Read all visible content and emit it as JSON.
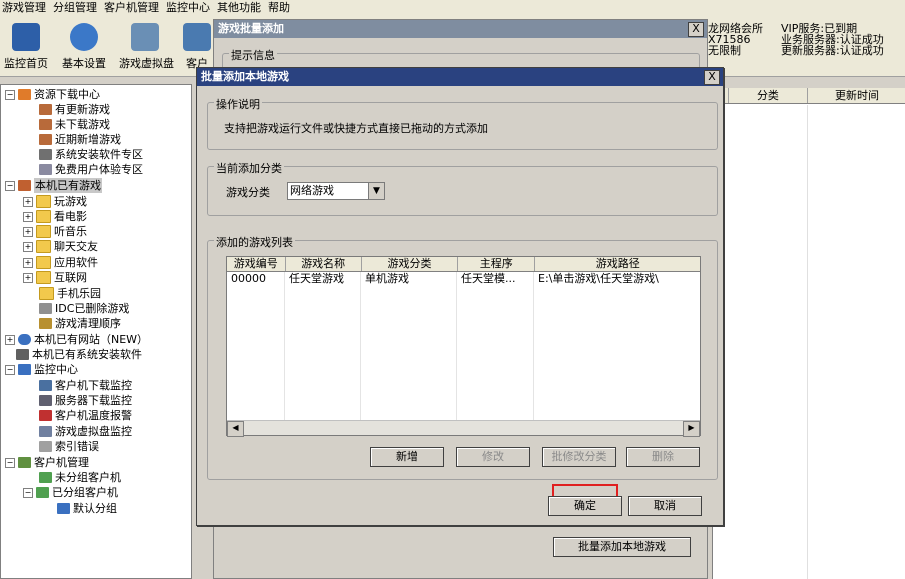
{
  "menu": [
    "游戏管理",
    "分组管理",
    "客户机管理",
    "监控中心",
    "其他功能",
    "帮助"
  ],
  "toolbar": {
    "monitor": "监控首页",
    "settings": "基本设置",
    "vdisk": "游戏虚拟盘",
    "partial": "客户"
  },
  "header_info": {
    "cafe": "龙网络会所",
    "code": "X71586",
    "limit": "无限制",
    "vip": "VIP服务:已到期",
    "biz_server": "业务服务器:认证成功",
    "update_server": "更新服务器:认证成功"
  },
  "tree": {
    "resource_center": "资源下载中心",
    "has_update": "有更新游戏",
    "not_downloaded": "未下载游戏",
    "recent_new": "近期新增游戏",
    "sys_software": "系统安装软件专区",
    "free_trial": "免费用户体验专区",
    "local_games": "本机已有游戏",
    "play_games": "玩游戏",
    "movies": "看电影",
    "music": "听音乐",
    "chat": "聊天交友",
    "apps": "应用软件",
    "internet": "互联网",
    "mobile": "手机乐园",
    "idc_deleted": "IDC已删除游戏",
    "cleanup_order": "游戏清理顺序",
    "local_sites": "本机已有网站（NEW）",
    "local_sys_software": "本机已有系统安装软件",
    "monitor_center": "监控中心",
    "client_download": "客户机下载监控",
    "server_download": "服务器下载监控",
    "client_temp": "客户机温度报警",
    "vdisk_monitor": "游戏虚拟盘监控",
    "index_error": "索引错误",
    "client_mgmt": "客户机管理",
    "ungrouped": "未分组客户机",
    "grouped": "已分组客户机",
    "default_group": "默认分组"
  },
  "right_panel": {
    "col_category": "分类",
    "col_update_time": "更新时间"
  },
  "back_dialog": {
    "title": "游戏批量添加",
    "close": "X",
    "group_label": "提示信息",
    "bottom_button": "批量添加本地游戏"
  },
  "front_dialog": {
    "title": "批量添加本地游戏",
    "close": "X",
    "instructions_label": "操作说明",
    "instructions_text": "支持把游戏运行文件或快捷方式直接已拖动的方式添加",
    "category_group_label": "当前添加分类",
    "category_label": "游戏分类",
    "category_value": "网络游戏",
    "list_group_label": "添加的游戏列表",
    "columns": [
      "游戏编号",
      "游戏名称",
      "游戏分类",
      "主程序",
      "游戏路径"
    ],
    "rows": [
      [
        "00000",
        "任天堂游戏",
        "单机游戏",
        "任天堂模...",
        "E:\\单击游戏\\任天堂游戏\\"
      ]
    ],
    "btn_add": "新增",
    "btn_edit": "修改",
    "btn_batch_category": "批修改分类",
    "btn_delete": "删除",
    "btn_ok": "确定",
    "btn_cancel": "取消"
  },
  "colors": {
    "active_title": "#2a4280",
    "inactive_title": "#7f8da0",
    "highlight": "#e02020"
  }
}
